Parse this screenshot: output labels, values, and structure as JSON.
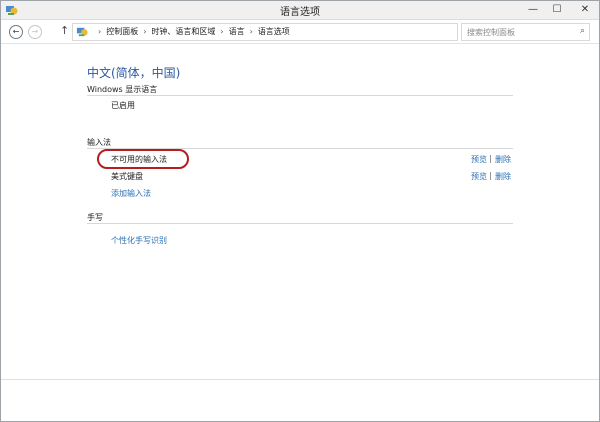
{
  "window": {
    "title": "语言选项",
    "controls": {
      "minimize": "—",
      "maximize": "☐",
      "close": "✕"
    }
  },
  "nav": {
    "back_icon": "←",
    "forward_icon": "→",
    "up_icon": "↑",
    "breadcrumbs": [
      "控制面板",
      "时钟、语言和区域",
      "语言",
      "语言选项"
    ],
    "separator": "›",
    "dropdown_icon": "⌄",
    "refresh_icon": "↻",
    "search_placeholder": "搜索控制面板",
    "search_icon": "⌕"
  },
  "content": {
    "language_title": "中文(简体，中国)",
    "display_language": {
      "heading": "Windows 显示语言",
      "status": "已启用"
    },
    "input_methods": {
      "heading": "输入法",
      "items": [
        {
          "label": "不可用的输入法",
          "preview": "预览",
          "remove": "删除"
        },
        {
          "label": "美式键盘",
          "preview": "预览",
          "remove": "删除"
        }
      ],
      "pipe": "|",
      "add_label": "添加输入法"
    },
    "handwriting": {
      "heading": "手写",
      "link": "个性化手写识别"
    }
  },
  "colors": {
    "title_blue": "#2a5aa0",
    "link_blue": "#2a6fb5",
    "highlight_red": "#b41e1e"
  }
}
